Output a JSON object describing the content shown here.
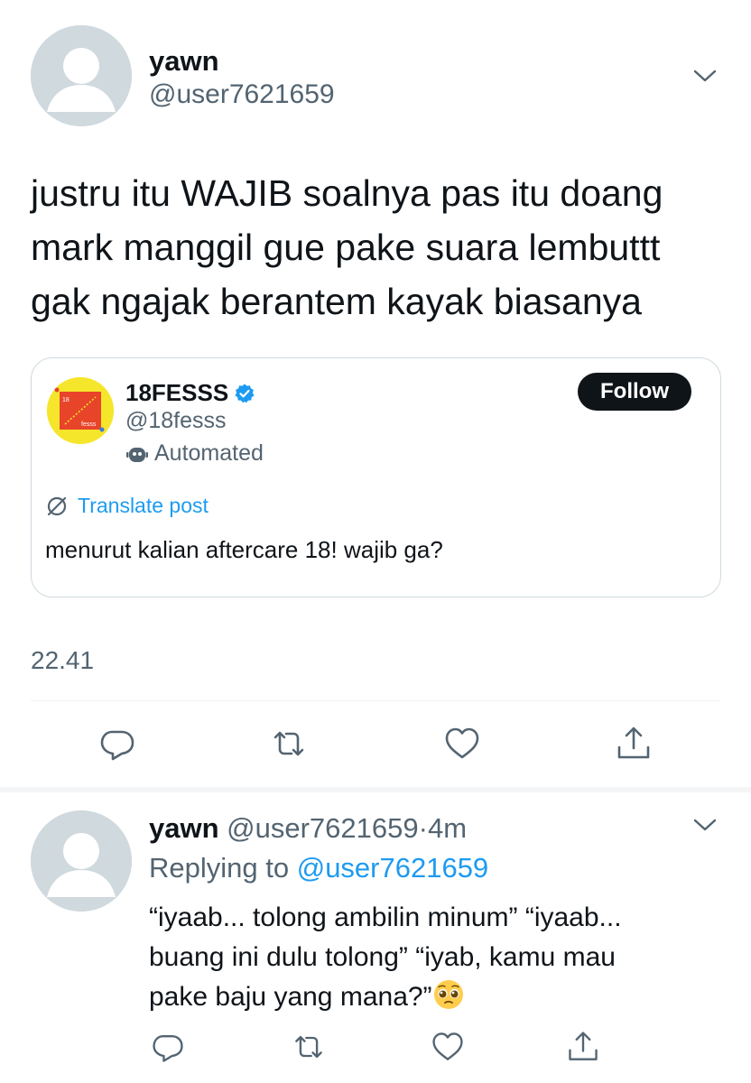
{
  "main_tweet": {
    "name": "yawn",
    "handle": "@user7621659",
    "text_lines": [
      "justru itu WAJIB soalnya pas itu doang",
      "mark manggil gue pake suara lembuttt",
      "gak ngajak berantem kayak biasanya"
    ],
    "timestamp": "22.41"
  },
  "quoted_post": {
    "name": "18FESSS",
    "verified": true,
    "handle": "@18fesss",
    "automated_label": "Automated",
    "follow_label": "Follow",
    "translate_label": "Translate post",
    "text": "menurut kalian aftercare 18! wajib ga?",
    "avatar_text": {
      "top": "18",
      "bottom": "fesss"
    }
  },
  "reply_tweet": {
    "name": "yawn",
    "handle": "@user7621659",
    "separator": "·",
    "time": "4m",
    "replying_prefix": "Replying to",
    "replying_to": "@user7621659",
    "text_lines": [
      "“iyaab... tolong ambilin minum” “iyaab...",
      "buang ini dulu tolong” “iyab, kamu mau",
      "pake baju yang mana?”"
    ],
    "emoji": "pleading-face"
  },
  "icons": {
    "reply": "reply-icon",
    "retweet": "retweet-icon",
    "like": "like-icon",
    "share": "share-icon",
    "more": "chevron-down-icon",
    "verified": "verified-badge-icon",
    "automated": "robot-icon",
    "translate": "translate-icon"
  },
  "colors": {
    "text": "#0f1419",
    "secondary": "#536471",
    "accent": "#1d9bf0",
    "border": "#cfd9de",
    "follow_bg": "#0f1419",
    "avatar_placeholder": "#cfd9de",
    "quoted_avatar_bg": "#f5e62b"
  }
}
